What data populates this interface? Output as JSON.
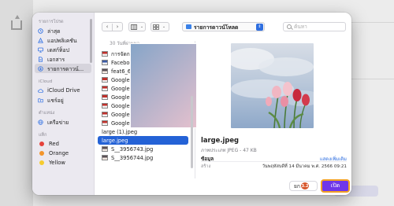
{
  "sidebar": {
    "favorites_header": "รายการโปรด",
    "favorites": [
      {
        "icon": "recents-clock-icon",
        "label": "ล่าสุด"
      },
      {
        "icon": "applications-icon",
        "label": "แอปพลิเคชัน"
      },
      {
        "icon": "desktop-icon",
        "label": "เดสก์ท็อป"
      },
      {
        "icon": "documents-icon",
        "label": "เอกสาร"
      },
      {
        "icon": "downloads-icon",
        "label": "รายการดาวน์..."
      }
    ],
    "icloud_header": "iCloud",
    "icloud": [
      {
        "icon": "icloud-icon",
        "label": "iCloud Drive"
      },
      {
        "icon": "shared-folder-icon",
        "label": "แชร์อยู่"
      }
    ],
    "locations_header": "ตำแหน่ง",
    "locations": [
      {
        "icon": "network-icon",
        "label": "เครือข่าย"
      }
    ],
    "tags_header": "แท็ก",
    "tags": [
      {
        "label": "Red",
        "color": "#e5423c"
      },
      {
        "label": "Orange",
        "color": "#f3952c"
      },
      {
        "label": "Yellow",
        "color": "#f6cb2f"
      }
    ]
  },
  "toolbar": {
    "back_label": "‹",
    "forward_label": "›",
    "location": "รายการดาวน์โหลด",
    "search_placeholder": "ค้นหา"
  },
  "file_list": {
    "header": "30 วันที่ผ่านมา",
    "items": [
      {
        "name": "การจัดการบทความ.jpg",
        "thumb": "red"
      },
      {
        "name": "Facebook.jpg",
        "thumb": "fb"
      },
      {
        "name": "feat6_6-omnichat.png",
        "thumb": "ppt"
      },
      {
        "name": "Google Analytics-01.jpg",
        "thumb": "red"
      },
      {
        "name": "Google Analytics-02.jpg",
        "thumb": "red"
      },
      {
        "name": "Google Analytics-03.jpg",
        "thumb": "red"
      },
      {
        "name": "Google sear...onsole-01.jpg",
        "thumb": "red"
      },
      {
        "name": "Google sear...onsole-02.jpg",
        "thumb": "red"
      },
      {
        "name": "Google sear...onsole-03.jpg",
        "thumb": "red"
      },
      {
        "name": "large (1).jpeg",
        "thumb": "photo"
      },
      {
        "name": "large.jpeg",
        "thumb": "photo",
        "selected": true
      },
      {
        "name": "S__3956743.jpg",
        "thumb": "ppt"
      },
      {
        "name": "S__3956744.jpg",
        "thumb": "ppt"
      }
    ]
  },
  "preview": {
    "filename": "large.jpeg",
    "type": "ภาพประเภท JPEG - 47 KB",
    "info_label": "ข้อมูล",
    "more_label": "แสดงเพิ่มเติม",
    "created_label": "สร้าง",
    "created_value": "วันพฤหัสบดีที่ 14 มีนาคม พ.ศ. 2566 09:21"
  },
  "footer": {
    "cancel_label": "ยกเลิก",
    "badge": "3.2",
    "open_label": "เปิด"
  },
  "colors": {
    "accent": "#2462d6",
    "open_button": "#6f36ea",
    "open_button_border": "#f2a024",
    "badge": "#d7562b"
  }
}
